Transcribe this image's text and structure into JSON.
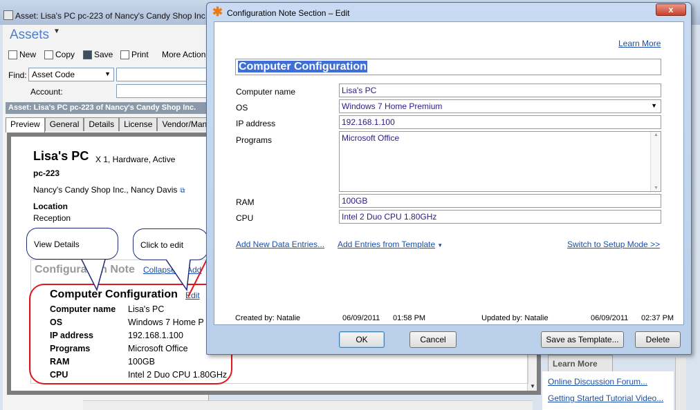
{
  "background_window": {
    "title": "Asset: Lisa's PC pc-223 of Nancy's Candy Shop Inc.",
    "module": "Assets",
    "toolbar": {
      "new": "New",
      "copy": "Copy",
      "save": "Save",
      "print": "Print",
      "more": "More Action"
    },
    "find_label": "Find:",
    "find_field": "Asset Code",
    "account_label": "Account:",
    "asset_header": "Asset: Lisa's PC pc-223 of Nancy's Candy Shop Inc.",
    "tabs": [
      "Preview",
      "General",
      "Details",
      "License",
      "Vendor/Man"
    ],
    "asset": {
      "name": "Lisa's PC",
      "meta": "X 1, Hardware, Active",
      "code": "pc-223",
      "owner": "Nancy's Candy Shop Inc., Nancy Davis",
      "location_label": "Location",
      "location": "Reception"
    },
    "config": {
      "title": "Configuration Note",
      "collapse": "Collapse",
      "add": "Add",
      "section_title": "Computer Configuration",
      "edit": "Edit",
      "rows": [
        {
          "key": "Computer name",
          "value": "Lisa's PC"
        },
        {
          "key": "OS",
          "value": "Windows 7 Home P"
        },
        {
          "key": "IP address",
          "value": "192.168.1.100"
        },
        {
          "key": "Programs",
          "value": "Microsoft Office"
        },
        {
          "key": "RAM",
          "value": "100GB"
        },
        {
          "key": "CPU",
          "value": "Intel 2 Duo CPU 1.80GHz"
        }
      ]
    },
    "callouts": {
      "view": "View Details",
      "click": "Click to edit"
    },
    "right_panel": {
      "tab": "Learn More",
      "forum": "Online Discussion Forum...",
      "tutorial": "Getting Started Tutorial Video..."
    }
  },
  "dialog": {
    "title": "Configuration Note Section – Edit",
    "close": "x",
    "learn_more": "Learn More",
    "section_title": "Computer Configuration",
    "fields": {
      "computer_name": {
        "label": "Computer name",
        "value": "Lisa's PC"
      },
      "os": {
        "label": "OS",
        "value": "Windows 7 Home Premium"
      },
      "ip": {
        "label": "IP address",
        "value": "192.168.1.100"
      },
      "programs": {
        "label": "Programs",
        "value": "Microsoft Office"
      },
      "ram": {
        "label": "RAM",
        "value": "100GB"
      },
      "cpu": {
        "label": "CPU",
        "value": "Intel 2 Duo CPU 1.80GHz"
      }
    },
    "links": {
      "add_new": "Add New Data Entries...",
      "add_template": "Add Entries from Template",
      "switch_setup": "Switch to Setup Mode >>"
    },
    "meta": {
      "created_by": "Created by: Natalie",
      "created_date": "06/09/2011",
      "created_time": "01:58 PM",
      "updated_by": "Updated by: Natalie",
      "updated_date": "06/09/2011",
      "updated_time": "02:37 PM"
    },
    "buttons": {
      "ok": "OK",
      "cancel": "Cancel",
      "save_template": "Save as Template...",
      "delete": "Delete"
    }
  },
  "colors": {
    "accent": "#1a4fa8",
    "annotation_red": "#e3151b",
    "callout_border": "#1f2a7a"
  }
}
